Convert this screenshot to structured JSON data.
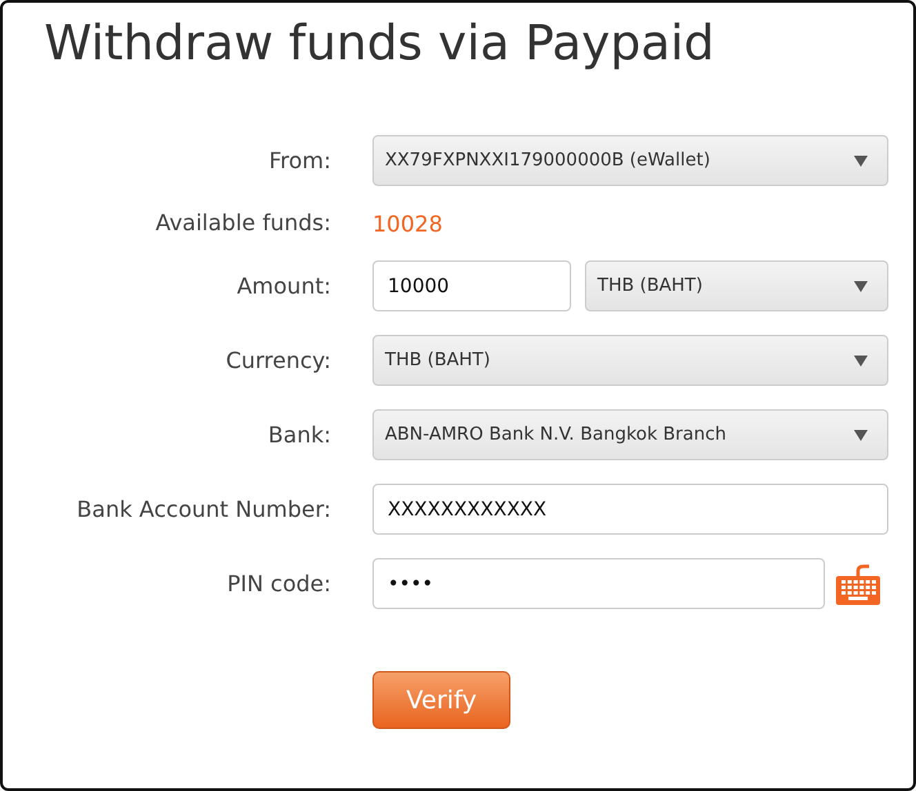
{
  "title": "Withdraw funds via Paypaid",
  "rows": [
    {
      "kind": "select",
      "label": "From:",
      "value": "XX79FXPNXXI179000000B (eWallet)"
    },
    {
      "kind": "text",
      "label": "Available funds:",
      "value": "10028"
    },
    {
      "kind": "amount",
      "label": "Amount:",
      "value": "10000",
      "unit": "THB (BAHT)"
    },
    {
      "kind": "select",
      "label": "Currency:",
      "value": "THB (BAHT)"
    },
    {
      "kind": "select",
      "label": "Bank:",
      "value": "ABN-AMRO Bank N.V. Bangkok Branch"
    },
    {
      "kind": "input",
      "label": "Bank Account Number:",
      "value": "XXXXXXXXXXXX"
    },
    {
      "kind": "pin",
      "label": "PIN code:",
      "value": "••••"
    }
  ],
  "button": "Verify"
}
